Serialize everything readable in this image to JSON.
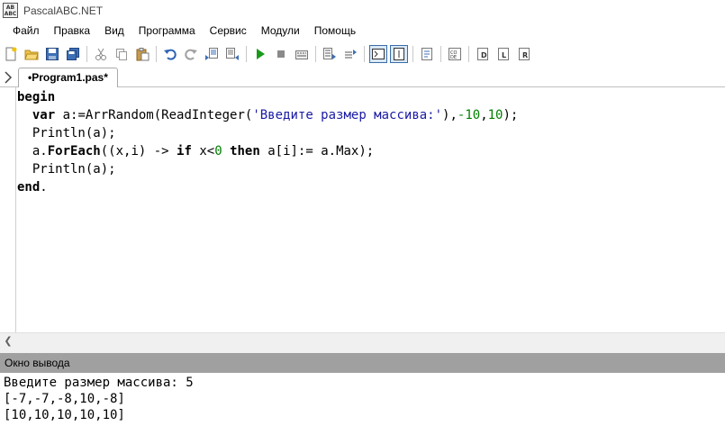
{
  "window": {
    "title": "PascalABC.NET",
    "icon_label_top": "AB",
    "icon_label_bottom": "ABC"
  },
  "menu": [
    "Файл",
    "Правка",
    "Вид",
    "Программа",
    "Сервис",
    "Модули",
    "Помощь"
  ],
  "toolbar": {
    "icons": [
      "new-file-icon",
      "open-file-icon",
      "save-icon",
      "save-all-icon",
      "cut-icon",
      "copy-icon",
      "paste-icon",
      "undo-icon",
      "redo-icon",
      "find-icon",
      "replace-icon",
      "run-icon",
      "stop-icon",
      "compile-icon",
      "step-into-icon",
      "step-over-icon",
      "output-window-toggle-icon",
      "debug-window-toggle-icon",
      "format-icon",
      "code-icon",
      "show-debug-icon",
      "show-locals-icon",
      "show-run-icon"
    ],
    "colors": {
      "run": "#1a9a1a",
      "stop": "#808080",
      "accent": "#3a6ea5"
    }
  },
  "editor": {
    "tab_label": "•Program1.pas*",
    "code": {
      "l1_kw": "begin",
      "l2_kw": "var",
      "l2_a": " a:=ArrRandom(ReadInteger(",
      "l2_str": "'Введите размер массива:'",
      "l2_b": "),",
      "l2_n1": "-10",
      "l2_c": ",",
      "l2_n2": "10",
      "l2_d": ");",
      "l3": "Println(a);",
      "l4_a": "a.",
      "l4_kw1": "ForEach",
      "l4_b": "((x,i) -> ",
      "l4_kw2": "if",
      "l4_c": " x<",
      "l4_n": "0",
      "l4_d": " ",
      "l4_kw3": "then",
      "l4_e": " a[i]:= a.Max);",
      "l5": "Println(a);",
      "l6_kw": "end",
      "l6_b": "."
    }
  },
  "output_window": {
    "title": "Окно вывода",
    "lines": [
      "Введите размер массива: 5",
      "[-7,-7,-8,10,-8]",
      "[10,10,10,10,10]"
    ]
  }
}
